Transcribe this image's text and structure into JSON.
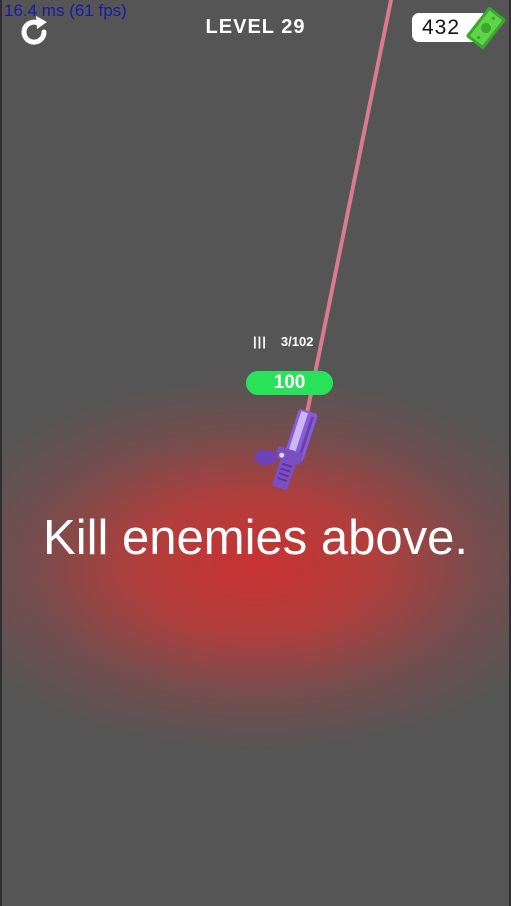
{
  "debug": {
    "fps_text": "16.4 ms (61 fps)"
  },
  "hud": {
    "restart_icon": "restart-icon",
    "level_text": "LEVEL 29",
    "money_value": "432",
    "money_icon": "cash-bill-icon"
  },
  "player": {
    "ammo_icon": "bullets-icon",
    "ammo_text": "3/102",
    "health_value": "100",
    "weapon_icon": "pistol-icon"
  },
  "hint_text": "Kill enemies above.",
  "colors": {
    "background": "#555555",
    "danger_glow": "#c83232",
    "laser": "#d87a90",
    "health_bar": "#28e35a",
    "weapon": "#7b4fc4",
    "cash": "#4cc43a",
    "debug_text": "#1a1aa8"
  }
}
